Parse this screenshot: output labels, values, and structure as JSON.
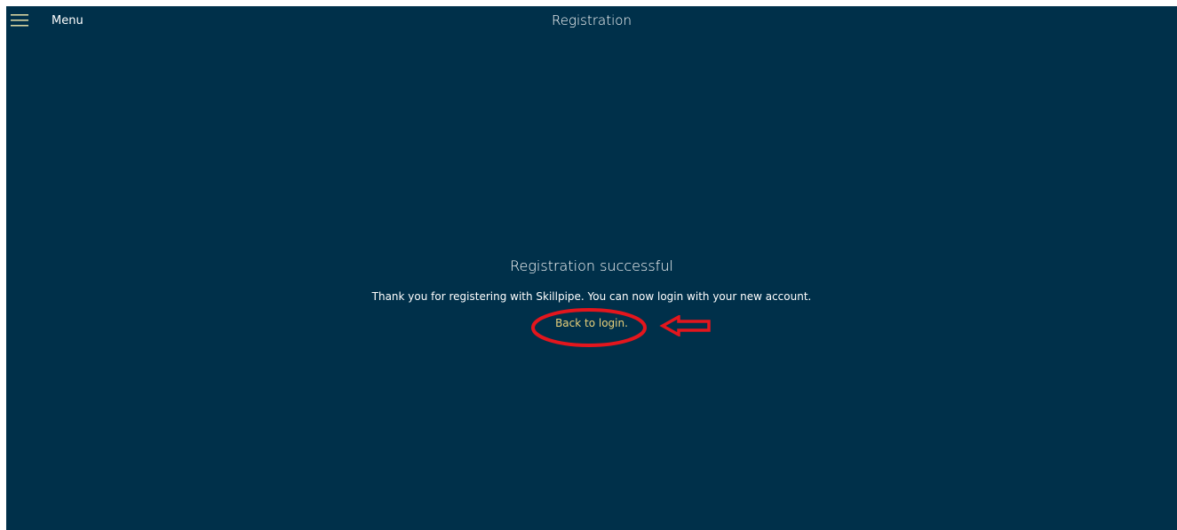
{
  "header": {
    "menu_label": "Menu",
    "title": "Registration"
  },
  "main": {
    "heading": "Registration successful",
    "message": "Thank you for registering with Skillpipe. You can now login with your new account.",
    "link_label": "Back to login."
  },
  "icons": {
    "menu": "hamburger-icon",
    "annotation_circle": "red-ellipse-annotation",
    "annotation_arrow": "red-arrow-annotation"
  },
  "colors": {
    "background": "#00304a",
    "text": "#ffffff",
    "link": "#e8d07a",
    "hamburger": "#d8d4a0",
    "annotation": "#e3161d"
  }
}
